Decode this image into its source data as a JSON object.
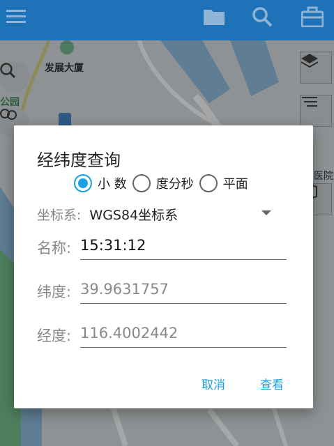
{
  "appbar": {
    "icons": [
      "menu-icon",
      "folder-icon",
      "search-icon",
      "toolbox-icon"
    ],
    "color": "#1e72b8"
  },
  "map": {
    "labels": {
      "building": "发展大厦",
      "park": "公园",
      "hospital": "医院"
    }
  },
  "dialog": {
    "title": "经纬度查询",
    "format_options": [
      {
        "label": "小 数",
        "selected": true
      },
      {
        "label": "度分秒",
        "selected": false
      },
      {
        "label": "平面",
        "selected": false
      }
    ],
    "crs": {
      "label": "坐标系:",
      "value": "WGS84坐标系"
    },
    "name_field": {
      "label": "名称:",
      "value": "15:31:12"
    },
    "lat_field": {
      "label": "纬度:",
      "placeholder": "39.9631757"
    },
    "lon_field": {
      "label": "经度:",
      "placeholder": "116.4002442"
    },
    "actions": {
      "cancel": "取消",
      "view": "查看"
    },
    "accent_color": "#1aa0e0"
  }
}
